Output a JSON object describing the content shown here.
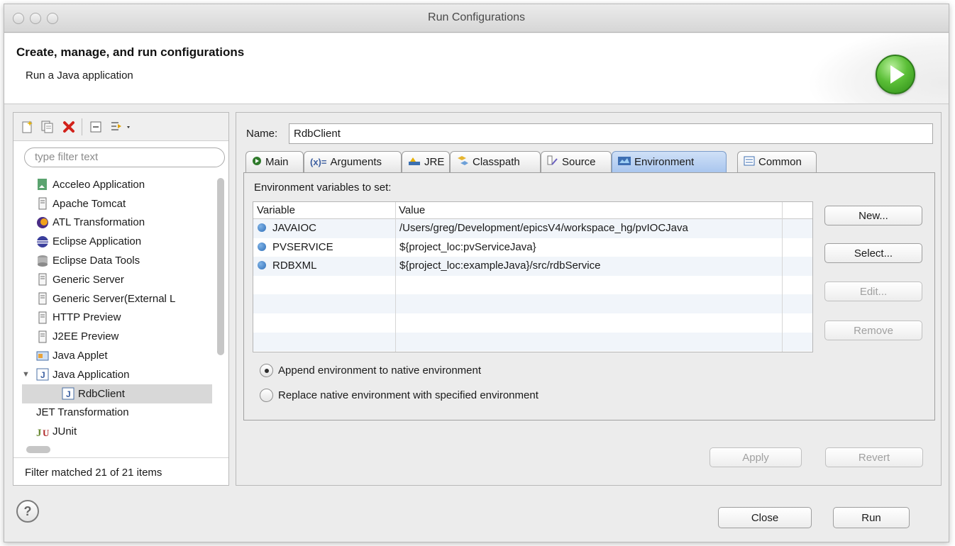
{
  "window": {
    "title": "Run Configurations"
  },
  "header": {
    "title": "Create, manage, and run configurations",
    "subtitle": "Run a Java application"
  },
  "left": {
    "filter_placeholder": "type filter text",
    "tree_items": [
      {
        "label": "Acceleo Application",
        "icon": "acceleo-icon"
      },
      {
        "label": "Apache Tomcat",
        "icon": "server-icon"
      },
      {
        "label": "ATL Transformation",
        "icon": "atl-icon"
      },
      {
        "label": "Eclipse Application",
        "icon": "eclipse-icon"
      },
      {
        "label": "Eclipse Data Tools",
        "icon": "database-icon"
      },
      {
        "label": "Generic Server",
        "icon": "server-icon"
      },
      {
        "label": "Generic Server(External L",
        "icon": "server-icon"
      },
      {
        "label": "HTTP Preview",
        "icon": "server-icon"
      },
      {
        "label": "J2EE Preview",
        "icon": "server-icon"
      },
      {
        "label": "Java Applet",
        "icon": "applet-icon"
      },
      {
        "label": "Java Application",
        "icon": "java-app-icon"
      },
      {
        "label": "RdbClient",
        "icon": "java-app-icon"
      },
      {
        "label": "JET Transformation",
        "icon": ""
      },
      {
        "label": "JUnit",
        "icon": "junit-icon"
      }
    ],
    "status": "Filter matched 21 of 21 items"
  },
  "name_label": "Name:",
  "name_value": "RdbClient",
  "tabs": [
    {
      "label": "Main",
      "icon": "main-icon"
    },
    {
      "label": "Arguments",
      "icon": "arguments-icon"
    },
    {
      "label": "JRE",
      "icon": "jre-icon"
    },
    {
      "label": "Classpath",
      "icon": "classpath-icon"
    },
    {
      "label": "Source",
      "icon": "source-icon"
    },
    {
      "label": "Environment",
      "icon": "environment-icon"
    },
    {
      "label": "Common",
      "icon": "common-icon"
    }
  ],
  "env": {
    "label": "Environment variables to set:",
    "col_variable": "Variable",
    "col_value": "Value",
    "rows": [
      {
        "variable": "JAVAIOC",
        "value": "/Users/greg/Development/epicsV4/workspace_hg/pvIOCJava"
      },
      {
        "variable": "PVSERVICE",
        "value": "${project_loc:pvServiceJava}"
      },
      {
        "variable": "RDBXML",
        "value": "${project_loc:exampleJava}/src/rdbService"
      }
    ],
    "buttons": {
      "new": "New...",
      "select": "Select...",
      "edit": "Edit...",
      "remove": "Remove"
    },
    "radio_append": "Append environment to native environment",
    "radio_replace": "Replace native environment with specified environment"
  },
  "actions": {
    "apply": "Apply",
    "revert": "Revert"
  },
  "footer": {
    "help": "?",
    "close": "Close",
    "run": "Run"
  }
}
